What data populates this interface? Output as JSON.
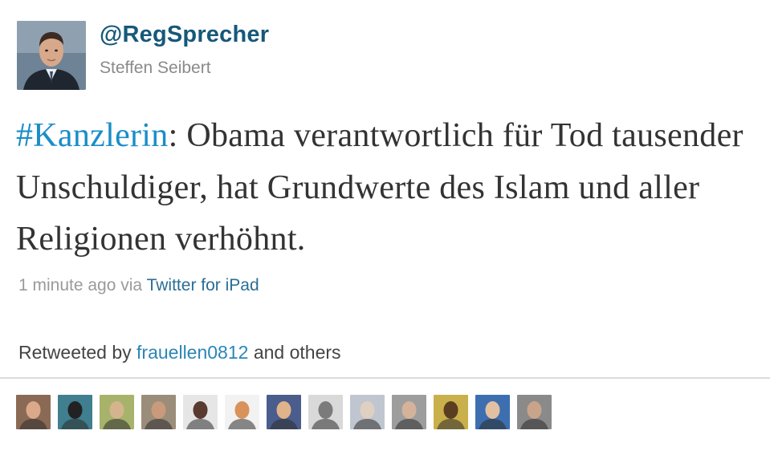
{
  "tweet": {
    "screen_name": "@RegSprecher",
    "full_name": "Steffen Seibert",
    "hashtag": "#Kanzlerin",
    "text_after_hashtag": ": Obama verantwortlich für Tod tausender Unschuldiger, hat Grundwerte des Islam und aller Religionen verhöhnt.",
    "timestamp": "1 minute ago",
    "via_text": "via",
    "source": "Twitter for iPad"
  },
  "retweet": {
    "prefix": "Retweeted by",
    "user": "frauellen0812",
    "suffix": "and others"
  },
  "colors": {
    "screen_name": "#16587a",
    "hashtag": "#1a8dc9",
    "link": "#2b86b8"
  },
  "retweeter_avatars": [
    {
      "name": "avatar-1",
      "bg": "#8a6a55",
      "face": "#d9a98a"
    },
    {
      "name": "avatar-2",
      "bg": "#3f7f8f",
      "face": "#222222"
    },
    {
      "name": "avatar-3",
      "bg": "#a7b36a",
      "face": "#d4b48f"
    },
    {
      "name": "avatar-4",
      "bg": "#9a8d7a",
      "face": "#c99a7c"
    },
    {
      "name": "avatar-5",
      "bg": "#e6e6e6",
      "face": "#5a3b30"
    },
    {
      "name": "avatar-6",
      "bg": "#f2f2f2",
      "face": "#d9925a"
    },
    {
      "name": "avatar-7",
      "bg": "#4a5d8c",
      "face": "#e1b38a"
    },
    {
      "name": "avatar-8",
      "bg": "#d9d9d9",
      "face": "#7b7b7b"
    },
    {
      "name": "avatar-9",
      "bg": "#c0c6cf",
      "face": "#e0d0c2"
    },
    {
      "name": "avatar-10",
      "bg": "#9d9d9d",
      "face": "#d4b39a"
    },
    {
      "name": "avatar-11",
      "bg": "#c9b04a",
      "face": "#5b3d22"
    },
    {
      "name": "avatar-12",
      "bg": "#3d6fb0",
      "face": "#e4c0a2"
    },
    {
      "name": "avatar-13",
      "bg": "#8a8a8a",
      "face": "#c8a48a"
    }
  ]
}
